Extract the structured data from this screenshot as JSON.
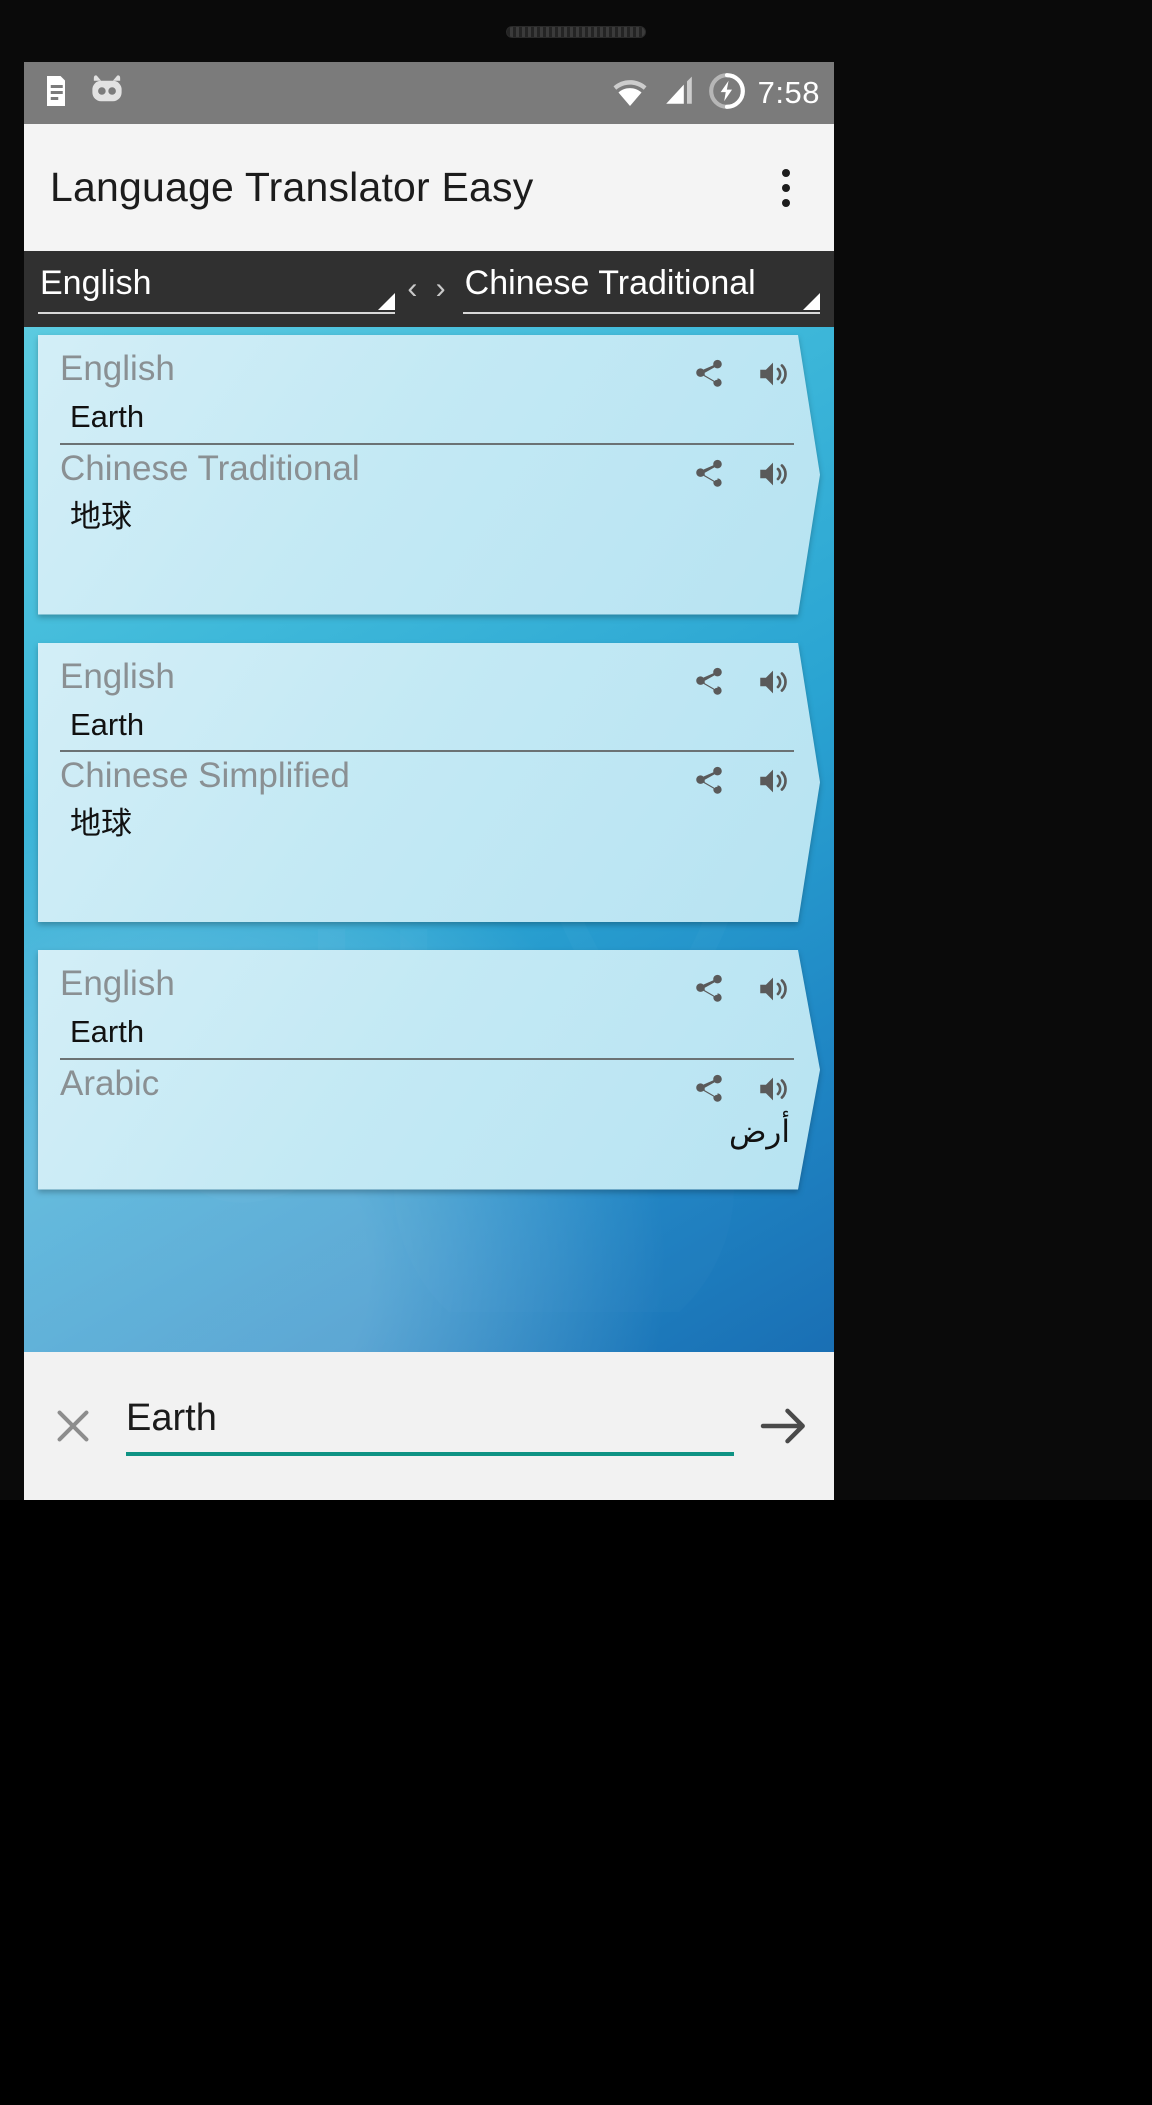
{
  "statusbar": {
    "time": "7:58",
    "icons_left": [
      "notification-document-icon",
      "cyanogenmod-icon"
    ],
    "icons_right": [
      "wifi-icon",
      "cellular-signal-icon",
      "battery-charging-icon"
    ]
  },
  "appbar": {
    "title": "Language Translator Easy",
    "overflow_label": "More options"
  },
  "language_bar": {
    "source_language": "English",
    "target_language": "Chinese Traditional",
    "swap_label": "‹ ›"
  },
  "cards": [
    {
      "source": {
        "language": "English",
        "text": "Earth",
        "rtl": false
      },
      "target": {
        "language": "Chinese Traditional",
        "text": "地球",
        "rtl": false
      }
    },
    {
      "source": {
        "language": "English",
        "text": "Earth",
        "rtl": false
      },
      "target": {
        "language": "Chinese Simplified",
        "text": "地球",
        "rtl": false
      }
    },
    {
      "source": {
        "language": "English",
        "text": "Earth",
        "rtl": false
      },
      "target": {
        "language": "Arabic",
        "text": "أرض",
        "rtl": true
      }
    }
  ],
  "input_bar": {
    "value": "Earth",
    "placeholder": "Enter text",
    "clear_label": "Clear",
    "send_label": "Translate"
  },
  "colors": {
    "accent_teal": "#0f9384",
    "card_bg": "#c3e9f4",
    "gradient_top": "#5ccbe0",
    "gradient_bottom": "#1a6fb4",
    "appbar_bg": "#f4f4f4",
    "langbar_bg": "#303030",
    "statusbar_bg": "#7b7b7b",
    "label_gray": "#8a9093"
  }
}
